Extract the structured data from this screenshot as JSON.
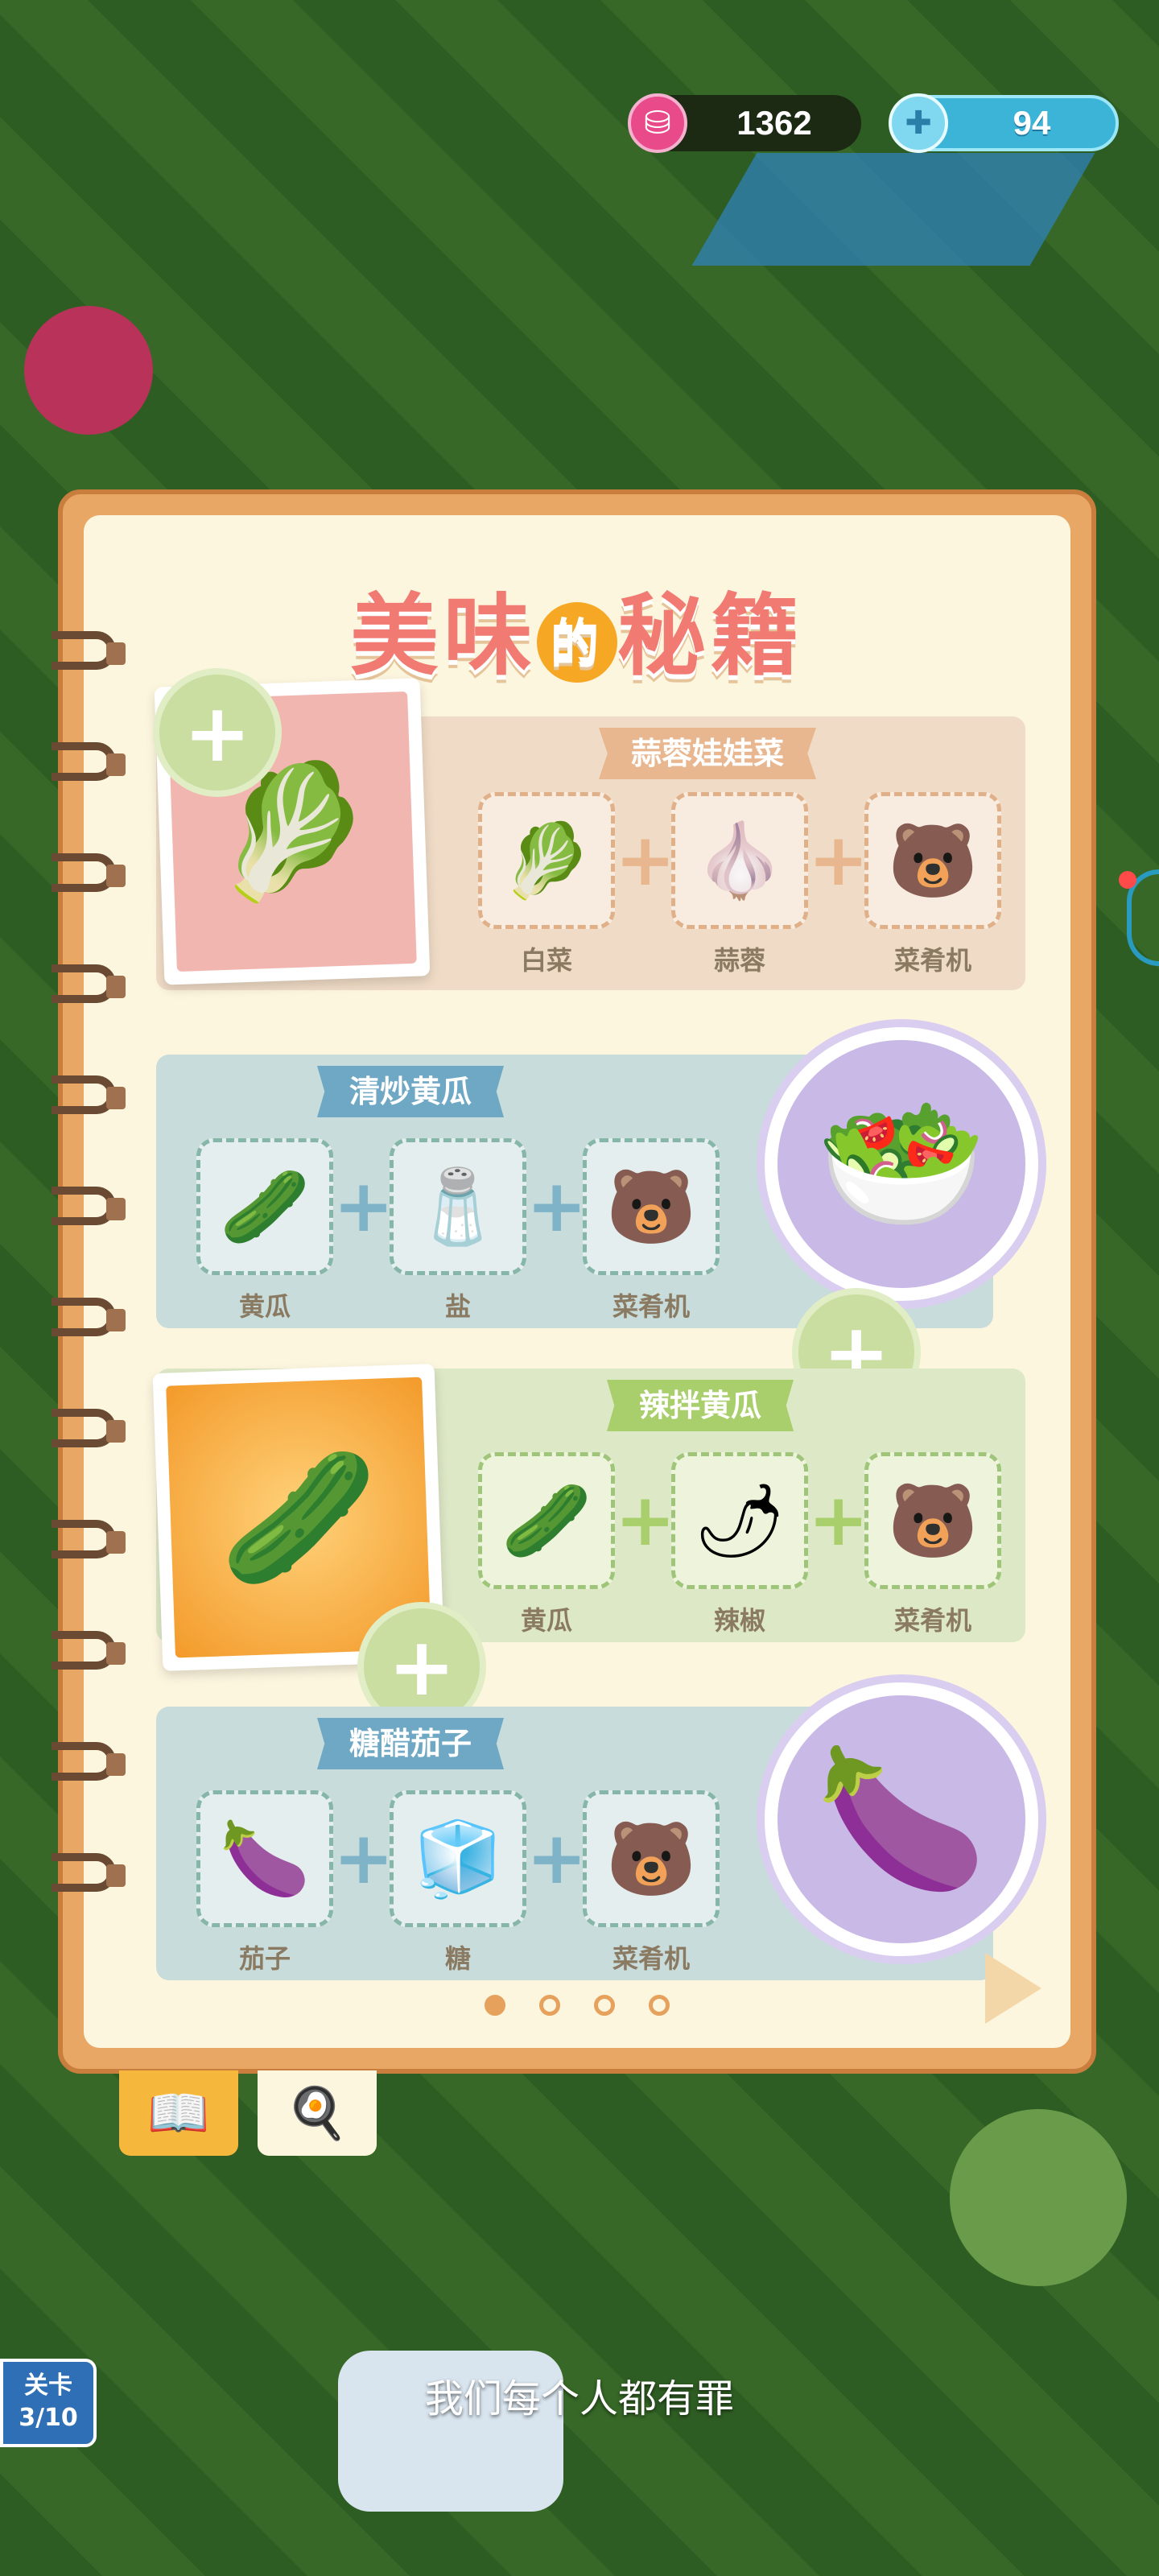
{
  "currencies": {
    "jam": {
      "icon": "jam-jar-icon",
      "value": "1362"
    },
    "gem": {
      "icon": "gem-plus-icon",
      "value": "94"
    }
  },
  "book": {
    "title_parts": [
      "美味",
      "的",
      "秘籍"
    ],
    "recipes": [
      {
        "name": "蒜蓉娃娃菜",
        "dish_icon": "🥬",
        "ingredients": [
          {
            "icon": "🥬",
            "label": "白菜"
          },
          {
            "icon": "🧄",
            "label": "蒜蓉"
          },
          {
            "icon": "🐻",
            "label": "菜肴机"
          }
        ]
      },
      {
        "name": "清炒黄瓜",
        "dish_icon": "🥗",
        "ingredients": [
          {
            "icon": "🥒",
            "label": "黄瓜"
          },
          {
            "icon": "🧂",
            "label": "盐"
          },
          {
            "icon": "🐻",
            "label": "菜肴机"
          }
        ]
      },
      {
        "name": "辣拌黄瓜",
        "dish_icon": "🥒",
        "ingredients": [
          {
            "icon": "🥒",
            "label": "黄瓜"
          },
          {
            "icon": "🌶",
            "label": "辣椒"
          },
          {
            "icon": "🐻",
            "label": "菜肴机"
          }
        ]
      },
      {
        "name": "糖醋茄子",
        "dish_icon": "🍆",
        "ingredients": [
          {
            "icon": "🍆",
            "label": "茄子"
          },
          {
            "icon": "🧊",
            "label": "糖"
          },
          {
            "icon": "🐻",
            "label": "菜肴机"
          }
        ]
      }
    ],
    "pager": {
      "total": 4,
      "current": 1
    },
    "tabs": [
      {
        "icon": "recipe-book-icon",
        "glyph": "📖"
      },
      {
        "icon": "chef-hat-icon",
        "glyph": "🍳"
      }
    ]
  },
  "subtitle": "我们每个人都有罪",
  "level_badge": {
    "label": "关卡",
    "progress": "3/10"
  },
  "colors": {
    "accent": "#f5b83c",
    "book_border": "#e9a766"
  }
}
